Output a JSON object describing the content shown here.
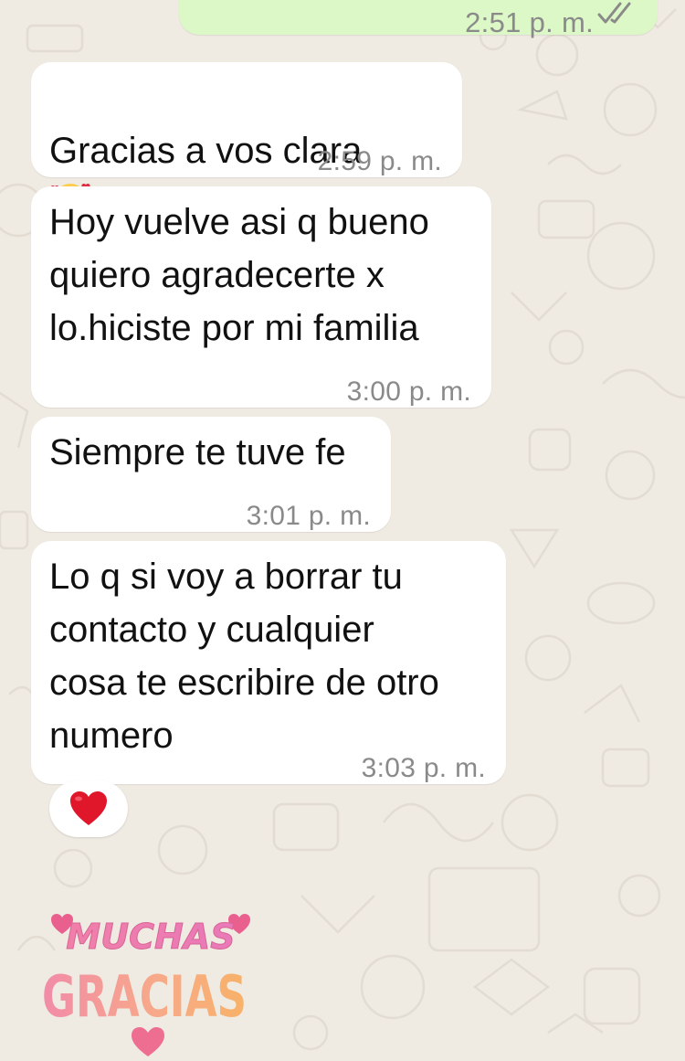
{
  "chat": {
    "messages": [
      {
        "id": "m0",
        "direction": "outgoing",
        "time": "2:51 p. m.",
        "status_icon": "double-check-read-icon"
      },
      {
        "id": "m1",
        "direction": "incoming",
        "text": "Gracias a vos clara",
        "emoji": "smiling-face-with-hearts",
        "time": "2:59 p. m."
      },
      {
        "id": "m2",
        "direction": "incoming",
        "text": "Hoy vuelve asi q bueno\nquiero agradecerte x\nlo.hiciste por mi familia",
        "time": "3:00 p. m."
      },
      {
        "id": "m3",
        "direction": "incoming",
        "text": "Siempre te tuve fe",
        "time": "3:01 p. m."
      },
      {
        "id": "m4",
        "direction": "incoming",
        "text": "Lo q si voy a borrar tu\ncontacto y cualquier\ncosa te escribire de otro\nnumero",
        "time": "3:03 p. m.",
        "reaction": "❤️"
      }
    ],
    "sticker": {
      "line1": "MUCHAS",
      "line2": "GRACIAS"
    }
  },
  "colors": {
    "background": "#EFEAE2",
    "incoming_bubble": "#FFFFFF",
    "outgoing_bubble": "#DCF8C6",
    "timestamp": "#8A8A8A",
    "read_ticks": "#53BDEB"
  }
}
